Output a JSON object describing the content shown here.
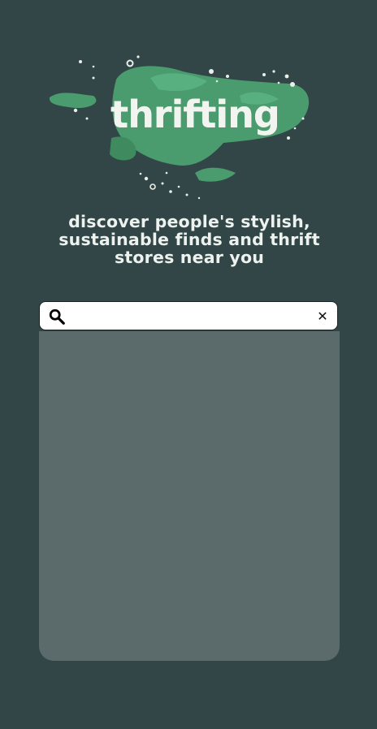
{
  "logo": {
    "text": "thrifting",
    "icon": "green-blob-logo",
    "colors": {
      "blob_main": "#4a9c6f",
      "blob_light": "#58b081",
      "blob_dark": "#3f8a5f"
    }
  },
  "tagline": "discover people's stylish, sustainable finds and thrift stores near you",
  "search": {
    "placeholder": "",
    "value": "",
    "search_icon": "search-icon",
    "clear_icon": "close-icon",
    "clear_glyph": "✕"
  },
  "results": {
    "background": "#5b6b6b"
  },
  "theme": {
    "page_background": "#324647",
    "text_color": "#eef2ee"
  }
}
